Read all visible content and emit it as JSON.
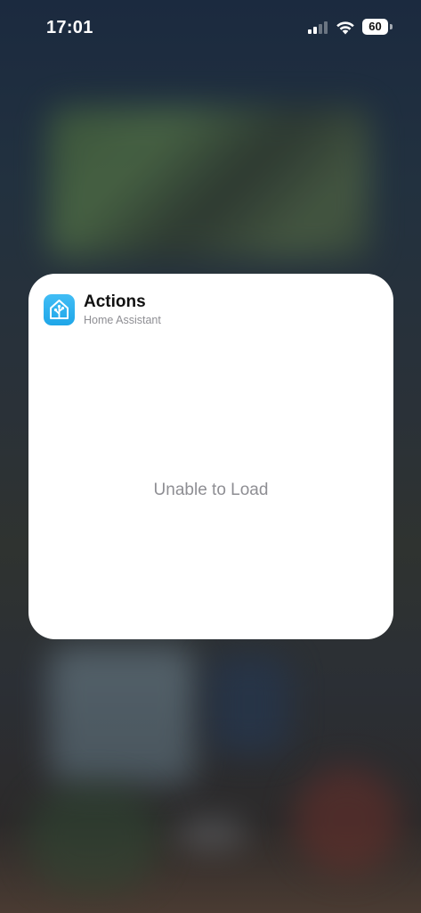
{
  "status_bar": {
    "time": "17:01",
    "battery_level": "60",
    "icons": [
      "cellular-signal-icon",
      "wifi-icon",
      "battery-icon"
    ]
  },
  "widget": {
    "title": "Actions",
    "subtitle": "Home Assistant",
    "message": "Unable to Load",
    "app_icon": "home-assistant-icon",
    "accent_color": "#41bdf5"
  }
}
